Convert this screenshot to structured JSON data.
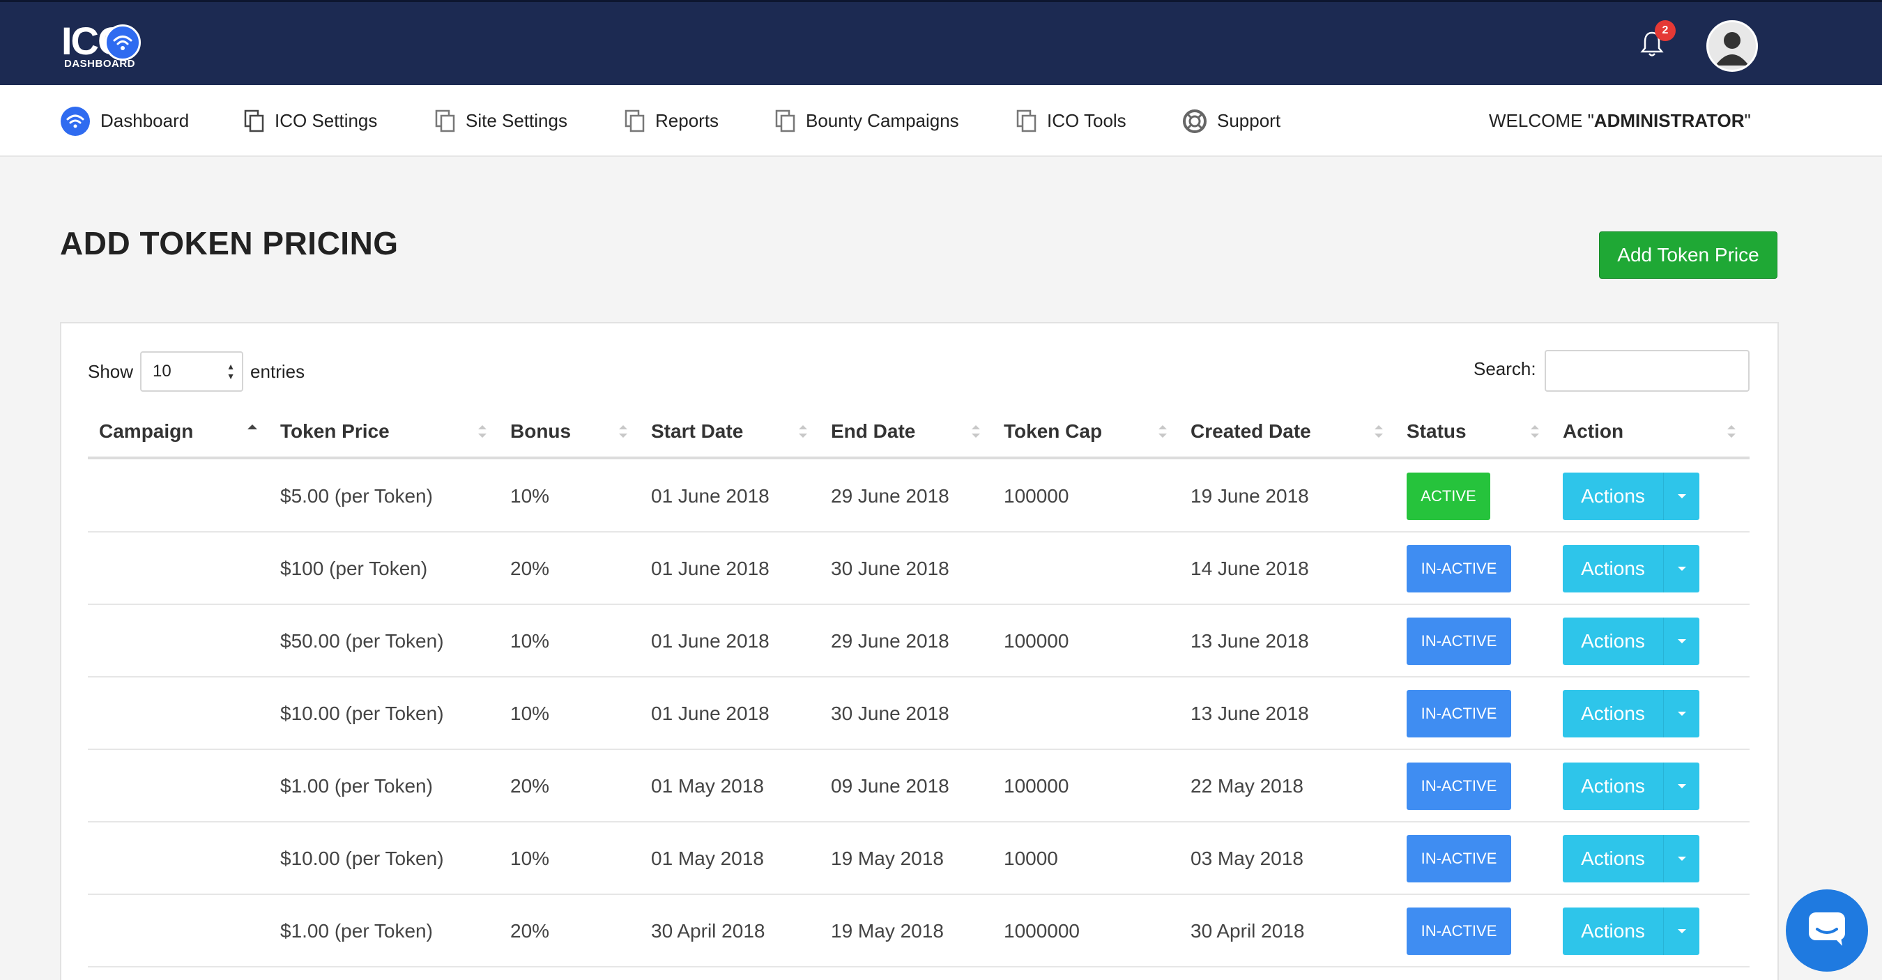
{
  "header": {
    "logo_text": "ICO",
    "logo_subtext": "DASHBOARD",
    "notification_count": "2",
    "icons": [
      "wifi-icon",
      "bell-icon",
      "avatar-icon"
    ]
  },
  "nav": {
    "items": [
      {
        "label": "Dashboard",
        "icon": "wifi-icon"
      },
      {
        "label": "ICO Settings",
        "icon": "copy-icon"
      },
      {
        "label": "Site Settings",
        "icon": "copy-icon"
      },
      {
        "label": "Reports",
        "icon": "copy-icon"
      },
      {
        "label": "Bounty Campaigns",
        "icon": "copy-icon"
      },
      {
        "label": "ICO Tools",
        "icon": "copy-icon"
      },
      {
        "label": "Support",
        "icon": "lifebuoy-icon"
      }
    ],
    "welcome_prefix": "WELCOME \"",
    "welcome_user": "ADMINISTRATOR",
    "welcome_suffix": " \""
  },
  "page": {
    "title": "ADD TOKEN PRICING",
    "add_button": "Add Token Price"
  },
  "table_controls": {
    "show_label": "Show",
    "entries_value": "10",
    "entries_label": "entries",
    "search_label": "Search:",
    "search_value": ""
  },
  "table": {
    "columns": [
      "Campaign",
      "Token Price",
      "Bonus",
      "Start Date",
      "End Date",
      "Token Cap",
      "Created Date",
      "Status",
      "Action"
    ],
    "rows": [
      {
        "campaign": "",
        "price": "$5.00 (per Token)",
        "bonus": "10%",
        "start": "01 June 2018",
        "end": "29 June 2018",
        "cap": "100000",
        "created": "19 June 2018",
        "status": "ACTIVE",
        "action": "Actions"
      },
      {
        "campaign": "",
        "price": "$100 (per Token)",
        "bonus": "20%",
        "start": "01 June 2018",
        "end": "30 June 2018",
        "cap": "",
        "created": "14 June 2018",
        "status": "IN-ACTIVE",
        "action": "Actions"
      },
      {
        "campaign": "",
        "price": "$50.00 (per Token)",
        "bonus": "10%",
        "start": "01 June 2018",
        "end": "29 June 2018",
        "cap": "100000",
        "created": "13 June 2018",
        "status": "IN-ACTIVE",
        "action": "Actions"
      },
      {
        "campaign": "",
        "price": "$10.00 (per Token)",
        "bonus": "10%",
        "start": "01 June 2018",
        "end": "30 June 2018",
        "cap": "",
        "created": "13 June 2018",
        "status": "IN-ACTIVE",
        "action": "Actions"
      },
      {
        "campaign": "",
        "price": "$1.00 (per Token)",
        "bonus": "20%",
        "start": "01 May 2018",
        "end": "09 June 2018",
        "cap": "100000",
        "created": "22 May 2018",
        "status": "IN-ACTIVE",
        "action": "Actions"
      },
      {
        "campaign": "",
        "price": "$10.00 (per Token)",
        "bonus": "10%",
        "start": "01 May 2018",
        "end": "19 May 2018",
        "cap": "10000",
        "created": "03 May 2018",
        "status": "IN-ACTIVE",
        "action": "Actions"
      },
      {
        "campaign": "",
        "price": "$1.00 (per Token)",
        "bonus": "20%",
        "start": "30 April 2018",
        "end": "19 May 2018",
        "cap": "1000000",
        "created": "30 April 2018",
        "status": "IN-ACTIVE",
        "action": "Actions"
      }
    ]
  },
  "colors": {
    "header_bg": "#1c2a52",
    "add_button": "#1fa835",
    "status_active": "#26c33c",
    "status_inactive": "#3f8df2",
    "actions_button": "#2ec5ea",
    "chat_button": "#1f7ae0"
  }
}
